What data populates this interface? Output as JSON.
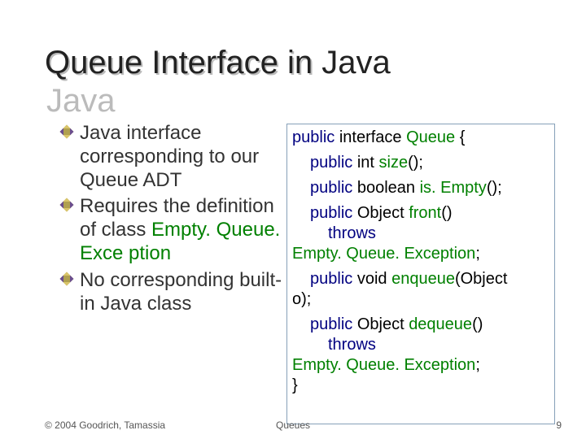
{
  "title": "Queue Interface in Java",
  "bullets": [
    {
      "parts": [
        {
          "text": "Java interface corresponding to our Queue ADT",
          "cls": "cc"
        }
      ]
    },
    {
      "parts": [
        {
          "text": "Requires the definition of class ",
          "cls": "cc"
        },
        {
          "text": "Empty. Queue. Exce ption",
          "cls": "id"
        }
      ]
    },
    {
      "parts": [
        {
          "text": "No corresponding built-in Java class",
          "cls": "cc"
        }
      ]
    }
  ],
  "code": {
    "l1a": "public",
    "l1b": " interface ",
    "l1c": "Queue",
    "l1d": " {",
    "l2a": "public",
    "l2b": " int ",
    "l2c": "size",
    "l2d": "();",
    "l3a": "public",
    "l3b": " boolean ",
    "l3c": "is. Empty",
    "l3d": "();",
    "l4a": "public",
    "l4b": " Object ",
    "l4c": "front",
    "l4d": "()",
    "l5": "throws",
    "l5b": "Empty. Queue. Exception",
    "l5c": ";",
    "l6a": "public",
    "l6b": " void ",
    "l6c": "enqueue",
    "l6d": "(Object",
    "l6e": "o);",
    "l7a": "public",
    "l7b": " Object ",
    "l7c": "dequeue",
    "l7d": "()",
    "l8a": "throws",
    "l8b": "Empty. Queue. Exception",
    "l8c": ";",
    "l9": "}"
  },
  "footer": {
    "copyright": "© 2004 Goodrich, Tamassia",
    "center": "Queues",
    "num": "9"
  }
}
